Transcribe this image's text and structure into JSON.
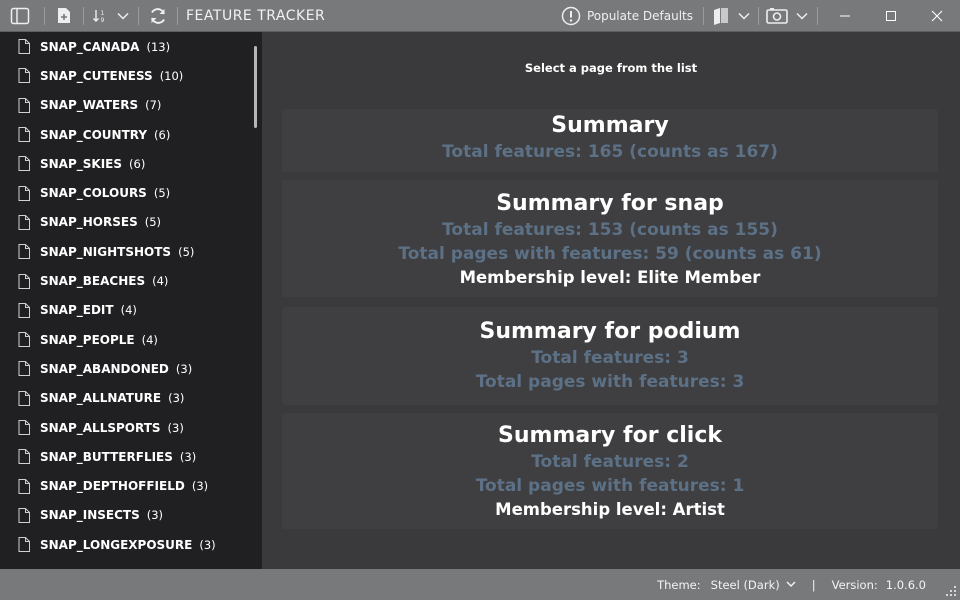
{
  "app": {
    "title": "FEATURE TRACKER",
    "populate_label": "Populate Defaults"
  },
  "sidebar": {
    "items": [
      {
        "name": "SNAP_CANADA",
        "count": "(13)"
      },
      {
        "name": "SNAP_CUTENESS",
        "count": "(10)"
      },
      {
        "name": "SNAP_WATERS",
        "count": "(7)"
      },
      {
        "name": "SNAP_COUNTRY",
        "count": "(6)"
      },
      {
        "name": "SNAP_SKIES",
        "count": "(6)"
      },
      {
        "name": "SNAP_COLOURS",
        "count": "(5)"
      },
      {
        "name": "SNAP_HORSES",
        "count": "(5)"
      },
      {
        "name": "SNAP_NIGHTSHOTS",
        "count": "(5)"
      },
      {
        "name": "SNAP_BEACHES",
        "count": "(4)"
      },
      {
        "name": "SNAP_EDIT",
        "count": "(4)"
      },
      {
        "name": "SNAP_PEOPLE",
        "count": "(4)"
      },
      {
        "name": "SNAP_ABANDONED",
        "count": "(3)"
      },
      {
        "name": "SNAP_ALLNATURE",
        "count": "(3)"
      },
      {
        "name": "SNAP_ALLSPORTS",
        "count": "(3)"
      },
      {
        "name": "SNAP_BUTTERFLIES",
        "count": "(3)"
      },
      {
        "name": "SNAP_DEPTHOFFIELD",
        "count": "(3)"
      },
      {
        "name": "SNAP_INSECTS",
        "count": "(3)"
      },
      {
        "name": "SNAP_LONGEXPOSURE",
        "count": "(3)"
      }
    ]
  },
  "main": {
    "prompt": "Select a page from the list",
    "summary": {
      "title": "Summary",
      "total": "Total features: 165 (counts as 167)"
    },
    "snap": {
      "title": "Summary for snap",
      "total": "Total features: 153 (counts as 155)",
      "pages": "Total pages with features: 59 (counts as 61)",
      "membership": "Membership level: Elite Member"
    },
    "podium": {
      "title": "Summary for podium",
      "total": "Total features: 3",
      "pages": "Total pages with features: 3"
    },
    "click": {
      "title": "Summary for click",
      "total": "Total features: 2",
      "pages": "Total pages with features: 1",
      "membership": "Membership level: Artist"
    }
  },
  "status": {
    "theme_label": "Theme:",
    "theme_value": "Steel (Dark)",
    "divider": "|",
    "version_label": "Version:",
    "version_value": "1.0.6.0"
  },
  "colors": {
    "titlebar": "#78797b",
    "sidebar": "#202022",
    "main": "#3a3a3c",
    "dim_text": "#5c7086"
  }
}
